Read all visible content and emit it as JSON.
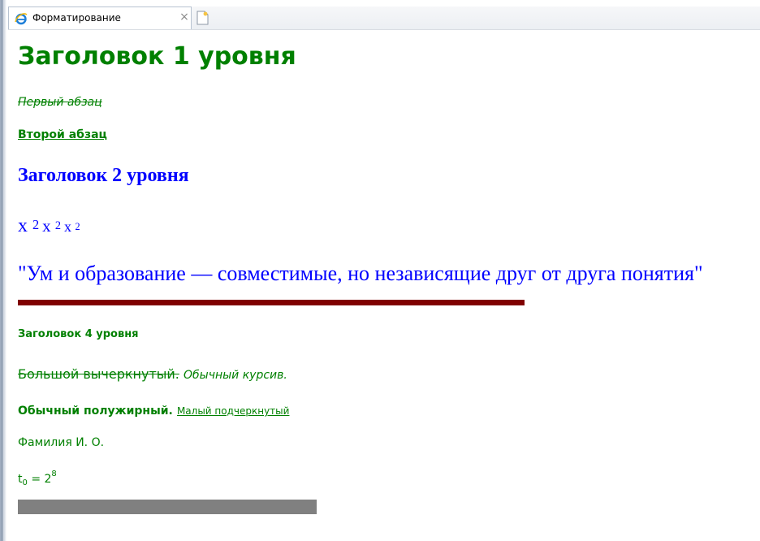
{
  "tab": {
    "title": "Форматирование",
    "close_label": "×",
    "icon": "ie-icon"
  },
  "new_tab": {
    "icon": "new-tab-icon"
  },
  "content": {
    "h1": "Заголовок 1 уровня",
    "p1": "Первый абзац",
    "p2": "Второй абзац",
    "h2": "Заголовок 2 уровня",
    "sup_line": {
      "base": "x",
      "exp": "2"
    },
    "quote": "\"Ум и образование — совместимые, но независящие друг от друга понятия\"",
    "h4": "Заголовок 4 уровня",
    "big_strike": "Большой вычеркнутый.",
    "italic": "Обычный курсив.",
    "bold": "Обычный полужирный.",
    "small_underline": "Малый подчеркнутый",
    "name": "Фамилия И. О.",
    "formula": {
      "t": "t",
      "sub": "0",
      "eq": " = 2",
      "sup": "8"
    }
  },
  "colors": {
    "text_green": "#008000",
    "text_blue": "#0000ff",
    "rule_dark": "#800000",
    "rule_gray": "#808080"
  }
}
